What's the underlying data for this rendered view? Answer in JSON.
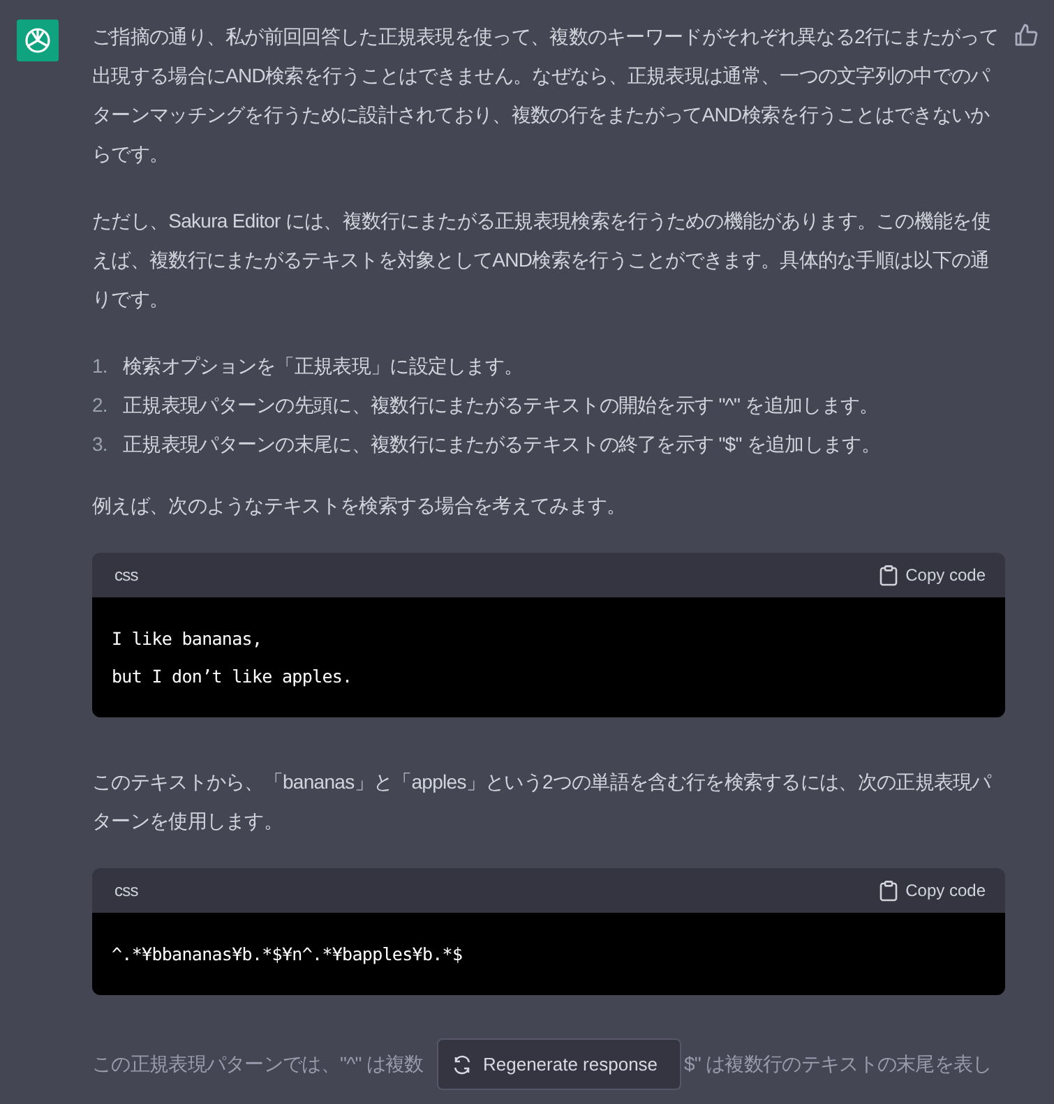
{
  "message": {
    "blocks": [
      {
        "kind": "paragraph",
        "text": "ご指摘の通り、私が前回回答した正規表現を使って、複数のキーワードがそれぞれ異なる2行にまたがって出現する場合にAND検索を行うことはできません。なぜなら、正規表現は通常、一つの文字列の中でのパターンマッチングを行うために設計されており、複数の行をまたがってAND検索を行うことはできないからです。"
      },
      {
        "kind": "paragraph",
        "text": "ただし、Sakura Editor には、複数行にまたがる正規表現検索を行うための機能があります。この機能を使えば、複数行にまたがるテキストを対象としてAND検索を行うことができます。具体的な手順は以下の通りです。"
      },
      {
        "kind": "list",
        "items": [
          {
            "number": "1.",
            "text": "検索オプションを「正規表現」に設定します。"
          },
          {
            "number": "2.",
            "text": "正規表現パターンの先頭に、複数行にまたがるテキストの開始を示す \"^\" を追加します。"
          },
          {
            "number": "3.",
            "text": "正規表現パターンの末尾に、複数行にまたがるテキストの終了を示す \"$\" を追加します。"
          }
        ]
      },
      {
        "kind": "paragraph",
        "text": "例えば、次のようなテキストを検索する場合を考えてみます。"
      },
      {
        "kind": "code",
        "language": "css",
        "copy_label": "Copy code",
        "lines": [
          "I like bananas,",
          "but I don’t like apples."
        ]
      },
      {
        "kind": "paragraph",
        "text": "このテキストから、「bananas」と「apples」という2つの単語を含む行を検索するには、次の正規表現パターンを使用します。"
      },
      {
        "kind": "code",
        "language": "css",
        "copy_label": "Copy code",
        "lines": [
          "^.*¥bbananas¥b.*$¥n^.*¥bapples¥b.*$"
        ]
      }
    ],
    "faded_paragraph": {
      "before_button": "この正規表現パターンでは、\"^\" は複数",
      "after_button": "$\" は複数行のテキストの末尾を表し"
    }
  },
  "regenerate_button": {
    "label": "Regenerate response"
  }
}
